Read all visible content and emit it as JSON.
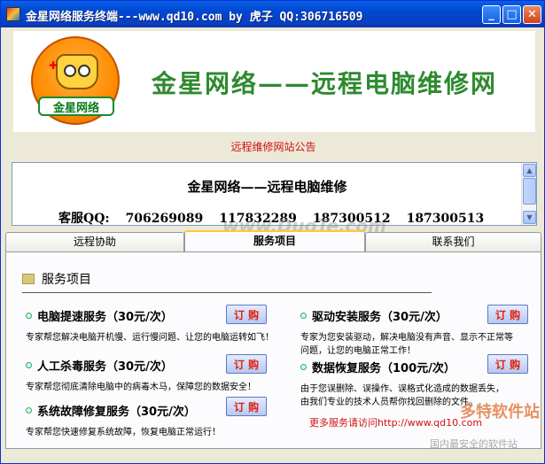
{
  "window": {
    "title": "金星网络服务终端---www.qd10.com by 虎子 QQ:306716509",
    "controls": {
      "minimize": "_",
      "maximize": "□",
      "close": "✕"
    }
  },
  "header": {
    "logo_text": "金星网络",
    "logo_cross": "✚",
    "title": "金星网络——远程电脑维修网"
  },
  "notice": {
    "label": "远程维修网站公告",
    "line1": "金星网络——远程电脑维修",
    "contact_label": "客服QQ:",
    "qq_numbers": [
      "706269089",
      "117832289",
      "187300512",
      "187300513"
    ]
  },
  "tabs": [
    {
      "label": "远程协助"
    },
    {
      "label": "服务项目"
    },
    {
      "label": "联系我们"
    }
  ],
  "panel": {
    "section_title": "服务项目",
    "services": [
      {
        "title": "电脑提速服务（30元/次）",
        "desc": "专家帮您解决电脑开机慢、运行慢问题、让您的电脑运转如飞！",
        "button": "订 购"
      },
      {
        "title": "人工杀毒服务（30元/次）",
        "desc": "专家帮您彻底清除电脑中的病毒木马，保障您的数据安全！",
        "button": "订 购"
      },
      {
        "title": "系统故障修复服务（30元/次）",
        "desc": "专家帮您快速修复系统故障，恢复电脑正常运行！",
        "button": "订 购"
      },
      {
        "title": "驱动安装服务（30元/次）",
        "desc": "专家为您安装驱动，解决电脑没有声音、显示不正常等",
        "desc2": "问题，让您的电脑正常工作！",
        "button": "订 购"
      },
      {
        "title": "数据恢复服务（100元/次）",
        "desc": "由于您误删除、误操作、误格式化造成的数据丢失，",
        "desc2": "由我们专业的技术人员帮你找回删除的文件。",
        "button": "订 购"
      }
    ],
    "more_link": "更多服务请访问http://www.qd10.com"
  },
  "watermarks": {
    "center": "www.DuoTe.com",
    "corner": "多特软件站",
    "corner_sub": "国内最安全的软件站"
  }
}
